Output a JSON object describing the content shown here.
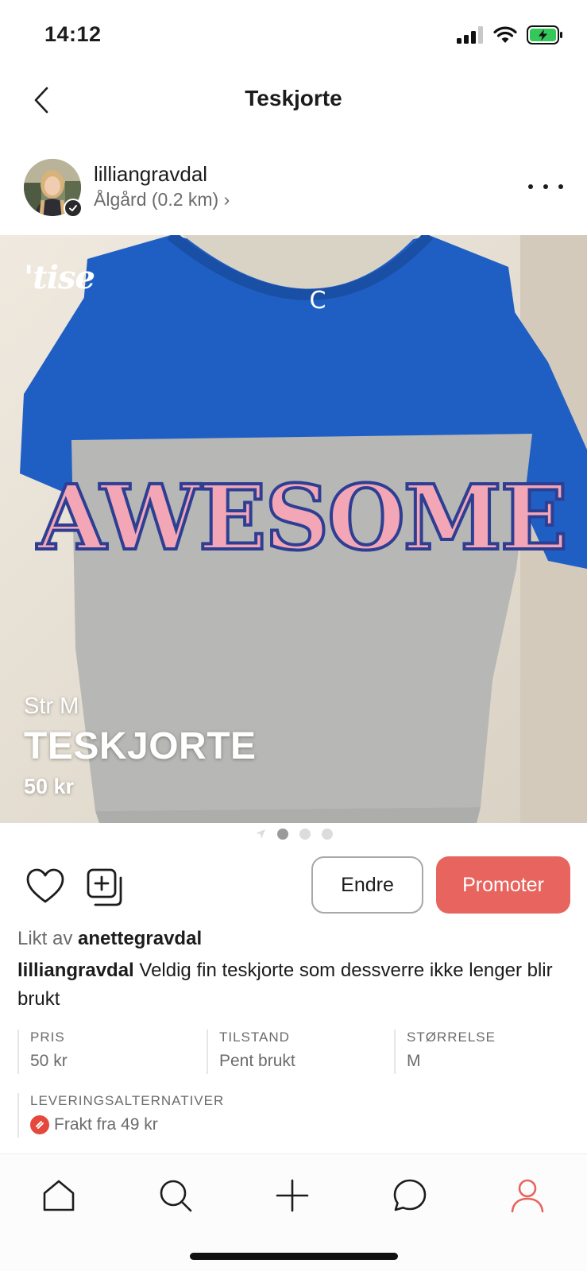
{
  "status_bar": {
    "time": "14:12"
  },
  "nav": {
    "title": "Teskjorte"
  },
  "seller": {
    "username": "lilliangravdal",
    "location": "Ålgård (0.2 km) ›"
  },
  "photo": {
    "logo": "'tise",
    "shirt_text": "AWESOME",
    "overlay_size": "Str M",
    "overlay_title": "TESKJORTE",
    "overlay_price": "50 kr",
    "pager": {
      "count": 3,
      "active_index": 0
    }
  },
  "actions": {
    "edit_label": "Endre",
    "promote_label": "Promoter"
  },
  "likes": {
    "prefix": "Likt av",
    "user": "anettegravdal"
  },
  "description": {
    "user": "lilliangravdal",
    "text": "Veldig fin teskjorte som dessverre ikke lenger blir brukt"
  },
  "details": [
    {
      "label": "PRIS",
      "value": "50 kr"
    },
    {
      "label": "TILSTAND",
      "value": "Pent brukt"
    },
    {
      "label": "STØRRELSE",
      "value": "M"
    }
  ],
  "delivery": {
    "label": "LEVERINGSALTERNATIVER",
    "value": "Frakt fra 49 kr"
  },
  "colors": {
    "accent": "#e8645e",
    "active_tab": "#e8645e",
    "shirt_blue": "#1f5fc4",
    "shirt_grey": "#b7b7b5",
    "shirt_letters": "#f2a6b6"
  },
  "tabs": [
    {
      "icon": "home-icon"
    },
    {
      "icon": "search-icon"
    },
    {
      "icon": "plus-icon"
    },
    {
      "icon": "chat-icon"
    },
    {
      "icon": "profile-icon",
      "active": true
    }
  ]
}
